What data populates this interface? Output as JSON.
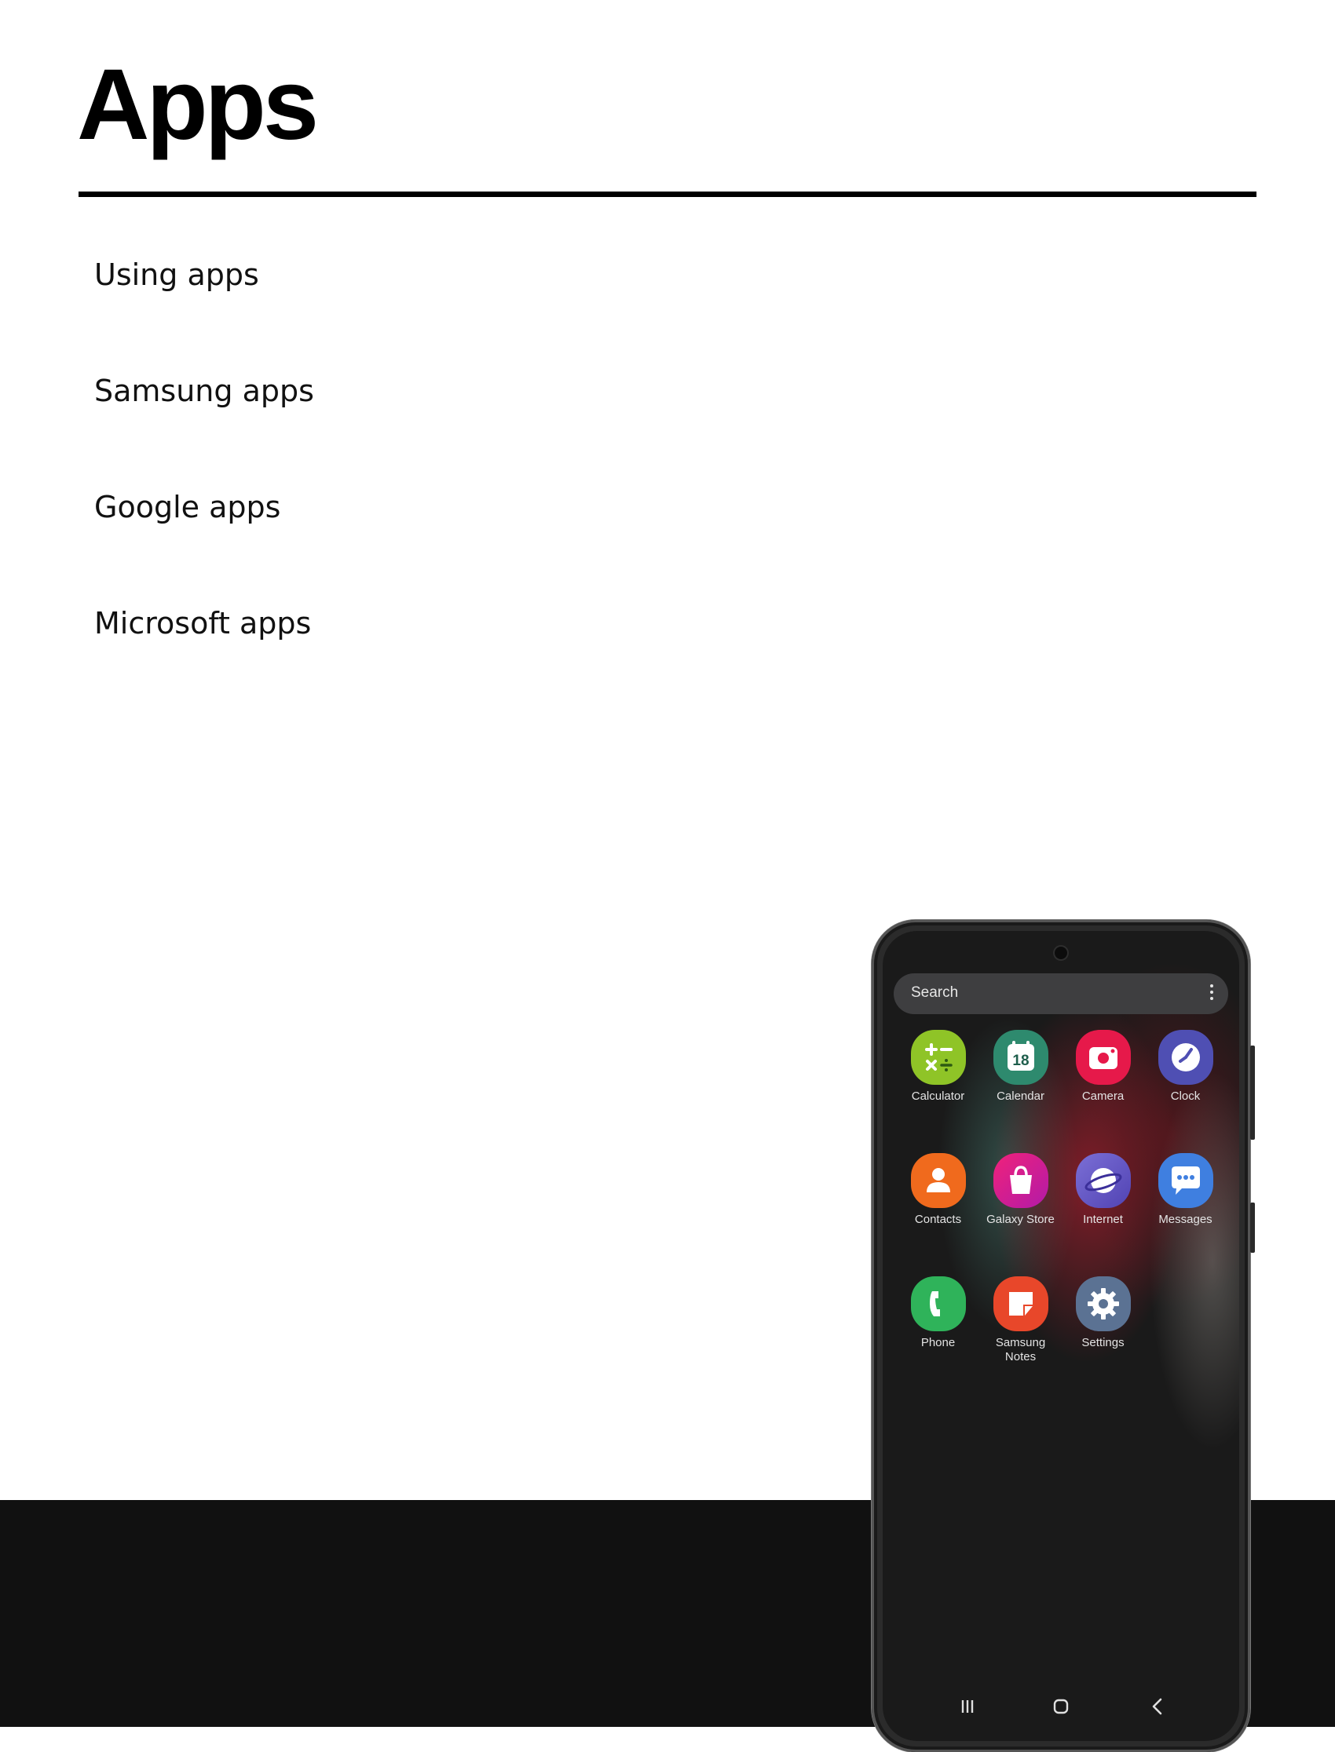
{
  "page": {
    "title": "Apps",
    "toc": [
      {
        "label": "Using apps"
      },
      {
        "label": "Samsung apps"
      },
      {
        "label": "Google apps"
      },
      {
        "label": "Microsoft apps"
      }
    ]
  },
  "phone": {
    "search": {
      "label": "Search",
      "menu_icon": "more-vertical-icon"
    },
    "apps": [
      {
        "label": "Calculator",
        "icon": "calculator-icon",
        "color": "#8fc427"
      },
      {
        "label": "Calendar",
        "icon": "calendar-icon",
        "color": "#2e8a6e",
        "day": "18"
      },
      {
        "label": "Camera",
        "icon": "camera-icon",
        "color": "#e6194a"
      },
      {
        "label": "Clock",
        "icon": "clock-icon",
        "color": "#4f4fb3"
      },
      {
        "label": "Contacts",
        "icon": "contacts-icon",
        "color": "#f06a1d"
      },
      {
        "label": "Galaxy Store",
        "icon": "galaxy-store-icon",
        "color": "#e0198c"
      },
      {
        "label": "Internet",
        "icon": "internet-icon",
        "color": "#6b5fc6"
      },
      {
        "label": "Messages",
        "icon": "messages-icon",
        "color": "#3f7fe0"
      },
      {
        "label": "Phone",
        "icon": "phone-icon",
        "color": "#2fb35a"
      },
      {
        "label": "Samsung Notes",
        "icon": "samsung-notes-icon",
        "color": "#e8472a"
      },
      {
        "label": "Settings",
        "icon": "settings-icon",
        "color": "#5b7293"
      }
    ],
    "navigation": [
      {
        "icon": "recent-apps-icon"
      },
      {
        "icon": "home-icon"
      },
      {
        "icon": "back-icon"
      }
    ]
  },
  "colors": {
    "band": "#111111",
    "rule": "#000000",
    "text": "#111111"
  }
}
